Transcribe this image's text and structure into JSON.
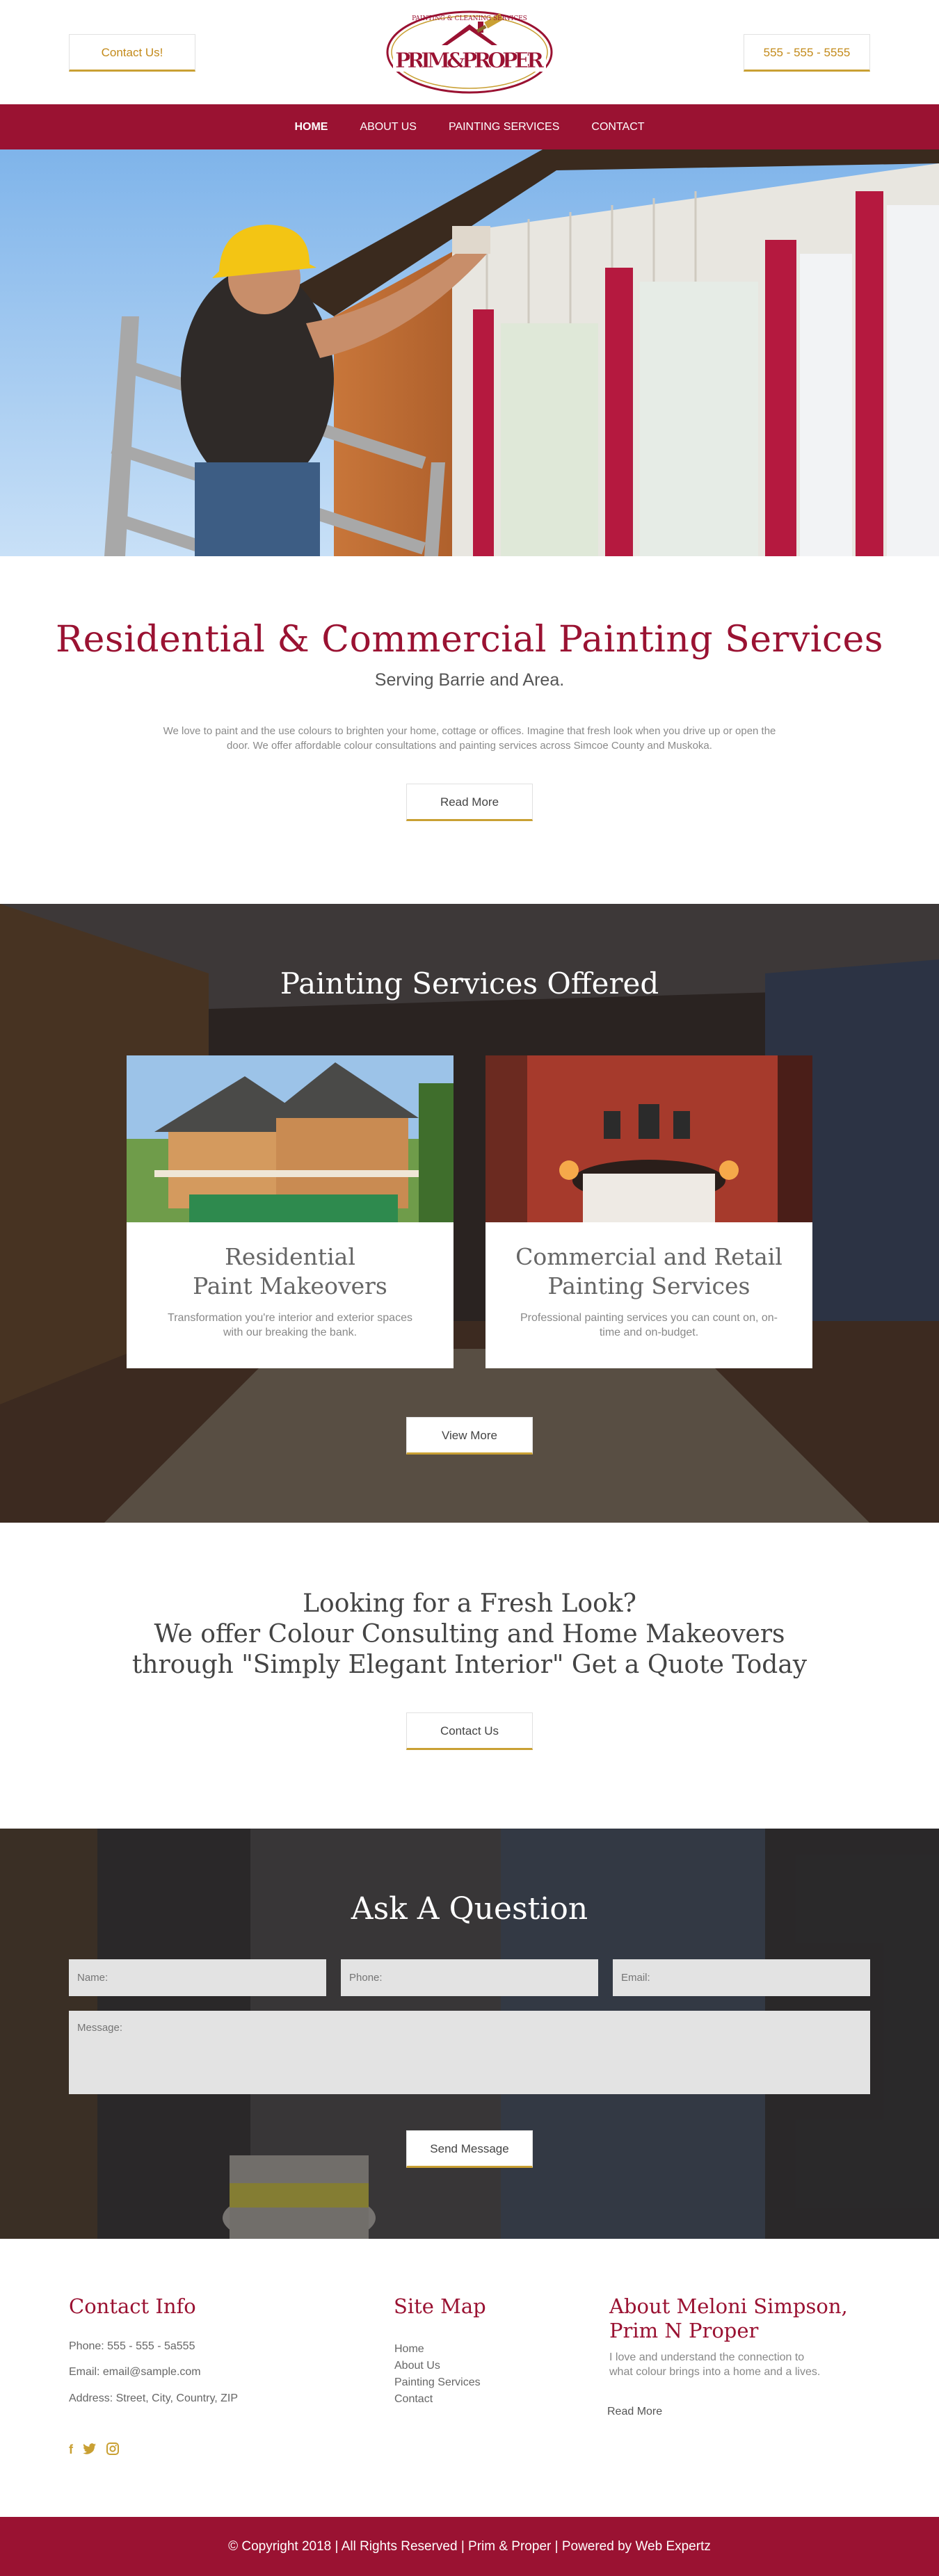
{
  "header": {
    "contact_label": "Contact Us!",
    "phone_label": "555 - 555 - 5555",
    "logo": {
      "top_text": "PAINTING & CLEANING SERVICES",
      "main_text": "PRIM&PROPER"
    }
  },
  "nav": {
    "items": [
      {
        "label": "HOME",
        "active": true
      },
      {
        "label": "ABOUT US",
        "active": false
      },
      {
        "label": "PAINTING SERVICES",
        "active": false
      },
      {
        "label": "CONTACT",
        "active": false
      }
    ]
  },
  "intro": {
    "title": "Residential & Commercial Painting Services",
    "subtitle": "Serving Barrie and Area.",
    "body": "We love to paint and the use colours to brighten your home, cottage or offices. Imagine that fresh look when you drive up or open the door. We offer affordable colour consultations and painting services across Simcoe County and Muskoka.",
    "button_label": "Read More"
  },
  "services": {
    "title": "Painting Services Offered",
    "cards": [
      {
        "title_line1": "Residential",
        "title_line2": "Paint Makeovers",
        "text": "Transformation you're interior and exterior spaces with our breaking the bank."
      },
      {
        "title_line1": "Commercial and Retail",
        "title_line2": "Painting Services",
        "text": "Professional painting services you can count on, on-time and on-budget."
      }
    ],
    "button_label": "View More"
  },
  "fresh": {
    "line1": "Looking for a Fresh Look?",
    "line2": "We offer Colour Consulting and Home Makeovers",
    "line3": "through \"Simply Elegant Interior\" Get a Quote Today",
    "button_label": "Contact Us"
  },
  "ask": {
    "title": "Ask A Question",
    "name_placeholder": "Name:",
    "phone_placeholder": "Phone:",
    "email_placeholder": "Email:",
    "message_placeholder": "Message:",
    "button_label": "Send Message"
  },
  "footer": {
    "contact_title": "Contact Info",
    "phone": "Phone: 555 - 555 - 5a555",
    "email": "Email: email@sample.com",
    "address": "Address: Street, City, Country, ZIP",
    "sitemap_title": "Site Map",
    "sitemap_links": [
      "Home",
      "About Us",
      "Painting Services",
      "Contact"
    ],
    "about_title_line1": "About Meloni Simpson,",
    "about_title_line2": "Prim N Proper",
    "about_text_line1": "I love and understand the connection to",
    "about_text_line2": "what colour brings into a home and a lives.",
    "about_link": "Read More",
    "social_icons": [
      "facebook-icon",
      "twitter-icon",
      "instagram-icon"
    ],
    "copyright": "© Copyright 2018 | All Rights Reserved | Prim & Proper | Powered by Web Expertz"
  },
  "colors": {
    "brand": "#9a1232",
    "accent": "#c9a033"
  }
}
